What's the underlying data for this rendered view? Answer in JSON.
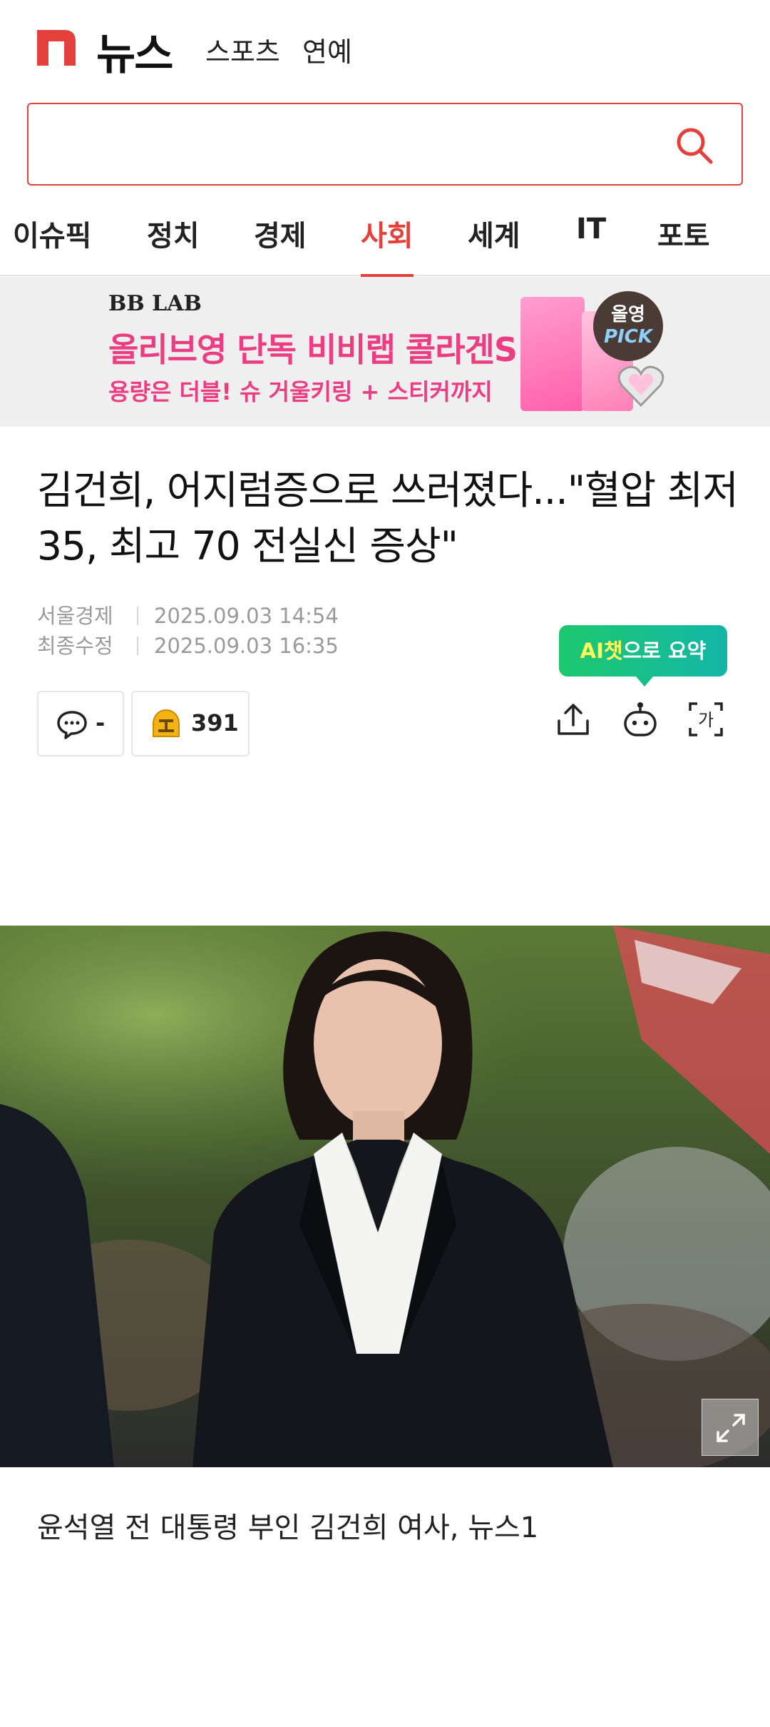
{
  "header": {
    "brand_title": "뉴스",
    "links": [
      "스포츠",
      "연예"
    ]
  },
  "search": {
    "placeholder": ""
  },
  "tabs": [
    {
      "label": "이슈픽",
      "active": false
    },
    {
      "label": "정치",
      "active": false
    },
    {
      "label": "경제",
      "active": false
    },
    {
      "label": "사회",
      "active": true
    },
    {
      "label": "세계",
      "active": false
    },
    {
      "label": "IT",
      "active": false
    },
    {
      "label": "포토",
      "active": false
    }
  ],
  "ad": {
    "brand": "BB LAB",
    "headline": "올리브영 단독 비비랩 콜라겐S",
    "subtext": "용량은 더블! 슈 거울키링 + 스티커까지",
    "badge_line1": "올영",
    "badge_line2": "PICK"
  },
  "article": {
    "headline": "김건희, 어지럼증으로 쓰러졌다...\"혈압 최저 35, 최고 70 전실신 증상\"",
    "publisher": "서울경제",
    "published": "2025.09.03 14:54",
    "modified_label": "최종수정",
    "modified": "2025.09.03 16:35",
    "comment_count": "-",
    "reaction_count": "391",
    "ai_summary_prefix": "AI챗",
    "ai_summary_suffix": "으로 요약",
    "photo_caption": "윤석열 전 대통령 부인 김건희 여사, 뉴스1"
  },
  "colors": {
    "accent": "#e4413c",
    "ad_pink": "#ec3d82",
    "ai_green": "#1ec86e"
  },
  "icons": [
    "naver-n-logo-icon",
    "search-icon",
    "comment-icon",
    "reaction-icon",
    "share-icon",
    "ai-bot-icon",
    "font-size-icon",
    "expand-icon"
  ]
}
